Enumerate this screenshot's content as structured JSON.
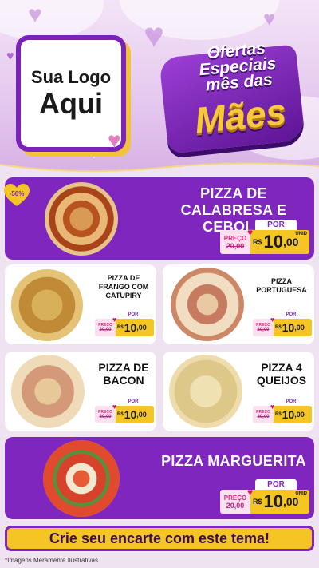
{
  "hero": {
    "logo_line1": "Sua Logo",
    "logo_line2": "Aqui",
    "badge_line1": "Ofertas",
    "badge_line2": "Especiais",
    "badge_line3": "mês das",
    "badge_line4": "Mães"
  },
  "discount_badge": "-50%",
  "labels": {
    "por": "POR",
    "preco": "PREÇO",
    "de": "DE",
    "currency": "R$",
    "unid": "UNID"
  },
  "products": [
    {
      "name": "PIZZA DE CALABRESA E CEBOLA",
      "old_price": "20,00",
      "price_int": "10",
      "price_dec": ",00"
    },
    {
      "name": "PIZZA DE FRANGO COM CATUPIRY",
      "old_price": "20,00",
      "price_int": "10",
      "price_dec": ",00"
    },
    {
      "name": "PIZZA PORTUGUESA",
      "old_price": "20,00",
      "price_int": "10",
      "price_dec": ",00"
    },
    {
      "name": "PIZZA DE BACON",
      "old_price": "20,00",
      "price_int": "10",
      "price_dec": ",00"
    },
    {
      "name": "PIZZA 4 QUEIJOS",
      "old_price": "20,00",
      "price_int": "10",
      "price_dec": ",00"
    },
    {
      "name": "PIZZA MARGUERITA",
      "old_price": "20,00",
      "price_int": "10",
      "price_dec": ",00"
    }
  ],
  "cta": "Crie seu encarte com este tema!",
  "footer_note": "*Imagens Meramente Ilustrativas",
  "colors": {
    "purple": "#7f26be",
    "yellow": "#f5c623",
    "pink": "#e0287c",
    "background": "#efe3f1"
  },
  "icons": [
    "heart-icon",
    "sparkle-icon"
  ]
}
